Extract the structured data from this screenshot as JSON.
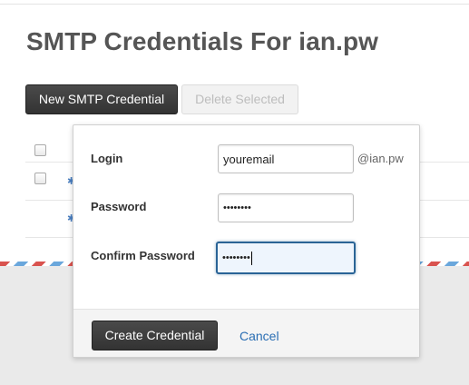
{
  "page": {
    "title": "SMTP Credentials For ian.pw"
  },
  "toolbar": {
    "new_label": "New SMTP Credential",
    "delete_label": "Delete Selected"
  },
  "popover": {
    "login_label": "Login",
    "login_value": "youremail",
    "domain_suffix": "@ian.pw",
    "password_label": "Password",
    "password_mask": "••••••••",
    "confirm_label": "Confirm Password",
    "confirm_mask": "••••••••",
    "create_label": "Create Credential",
    "cancel_label": "Cancel"
  },
  "icons": {
    "row_action": "gear-icon",
    "row_select": "checkbox"
  },
  "colors": {
    "primary_button": "#333333",
    "link": "#2a6eb3",
    "focus_border": "#2a6496"
  }
}
